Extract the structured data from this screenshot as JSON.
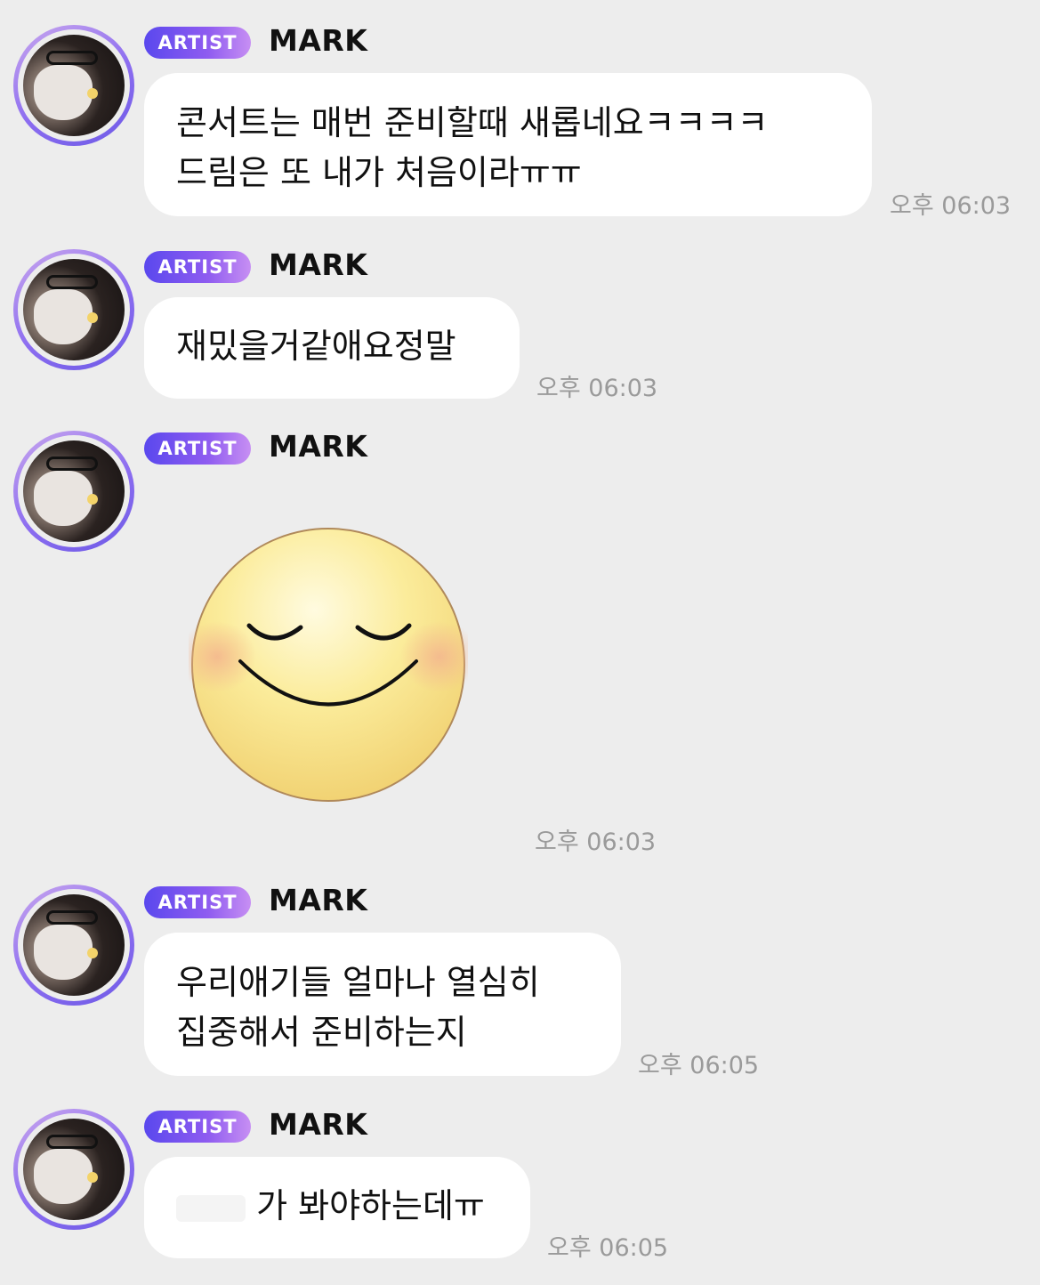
{
  "messages": [
    {
      "badge": "ARTIST",
      "name": "MARK",
      "lines": [
        "콘서트는 매번 준비할때 새롭네요ㅋㅋㅋㅋ",
        "드림은 또 내가 처음이라ㅠㅠ"
      ],
      "time": "오후 06:03"
    },
    {
      "badge": "ARTIST",
      "name": "MARK",
      "lines": [
        "재밌을거같애요정말"
      ],
      "time": "오후 06:03"
    },
    {
      "badge": "ARTIST",
      "name": "MARK",
      "sticker": "smiling-face-sticker",
      "time": "오후 06:03"
    },
    {
      "badge": "ARTIST",
      "name": "MARK",
      "lines": [
        "우리애기들 얼마나 열심히",
        "집중해서 준비하는지"
      ],
      "time": "오후 06:05"
    },
    {
      "badge": "ARTIST",
      "name": "MARK",
      "lines": [
        "가 봐야하는데ㅠ"
      ],
      "time": "오후 06:05"
    }
  ],
  "colors": {
    "background": "#ededed",
    "bubble": "#ffffff",
    "badge_gradient_start": "#5a48ee",
    "badge_gradient_end": "#c78ff3",
    "timestamp": "#9a9a9a"
  }
}
